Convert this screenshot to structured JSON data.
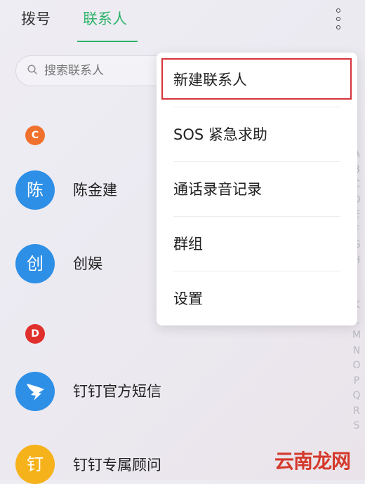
{
  "tabs": {
    "dial": "拨号",
    "contacts": "联系人"
  },
  "search": {
    "placeholder": "搜索联系人"
  },
  "sections": [
    {
      "letter": "C",
      "contacts": [
        {
          "name": "陈金建",
          "avatar_text": "陈"
        },
        {
          "name": "创娱",
          "avatar_text": "创"
        }
      ]
    },
    {
      "letter": "D",
      "contacts": [
        {
          "name": "钉钉官方短信",
          "avatar_icon": "dingtalk-logo-icon"
        },
        {
          "name": "钉钉专属顾问",
          "avatar_text": "钉"
        }
      ]
    }
  ],
  "index_letters": [
    "A",
    "B",
    "C",
    "D",
    "E",
    "F",
    "G",
    "H",
    "I",
    "J",
    "K",
    "L",
    "M",
    "N",
    "O",
    "P",
    "Q",
    "R",
    "S"
  ],
  "menu": {
    "items": [
      "新建联系人",
      "SOS 紧急求助",
      "通话录音记录",
      "群组",
      "设置"
    ],
    "highlighted_index": 0
  },
  "watermark": "云南龙网",
  "colors": {
    "accent_green": "#2eb36a",
    "badge_c": "#f0712d",
    "badge_d": "#e0302c",
    "avatar_blue": "#2e8fe6",
    "avatar_yellow": "#f6b21a",
    "highlight_red": "#d7323a"
  }
}
